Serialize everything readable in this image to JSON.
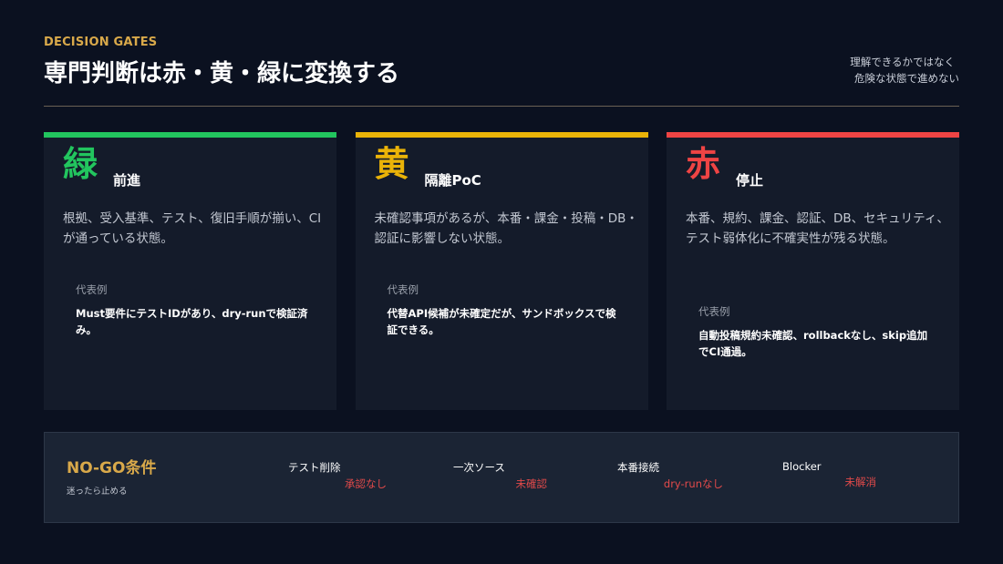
{
  "header": {
    "eyebrow": "DECISION GATES",
    "title": "専門判断は赤・黄・緑に変換する",
    "subtitle_line1": "理解できるかではなく",
    "subtitle_line2": "危険な状態で進めない"
  },
  "colors": {
    "accent": "#d9a94a",
    "green": "#22c55e",
    "yellow": "#eab308",
    "red": "#ef4444",
    "alert_text": "#e24a4a"
  },
  "cards": [
    {
      "big": "緑",
      "tag": "前進",
      "desc": "根拠、受入基準、テスト、復旧手順が揃い、CIが通っている状態。",
      "example_label": "代表例",
      "example_text": "Must要件にテストIDがあり、dry-runで検証済み。"
    },
    {
      "big": "黄",
      "tag": "隔離PoC",
      "desc": "未確認事項があるが、本番・課金・投稿・DB・認証に影響しない状態。",
      "example_label": "代表例",
      "example_text": "代替API候補が未確定だが、サンドボックスで検証できる。"
    },
    {
      "big": "赤",
      "tag": "停止",
      "desc": "本番、規約、課金、認証、DB、セキュリティ、テスト弱体化に不確実性が残る状態。",
      "example_label": "代表例",
      "example_text": "自動投稿規約未確認、rollbackなし、skip追加でCI通過。"
    }
  ],
  "nogo": {
    "title": "NO-GO条件",
    "subtitle": "迷ったら止める",
    "items": [
      {
        "label": "テスト削除",
        "value": "承認なし"
      },
      {
        "label": "一次ソース",
        "value": "未確認"
      },
      {
        "label": "本番接続",
        "value": "dry-runなし"
      },
      {
        "label": "Blocker",
        "value": "未解消"
      }
    ]
  }
}
